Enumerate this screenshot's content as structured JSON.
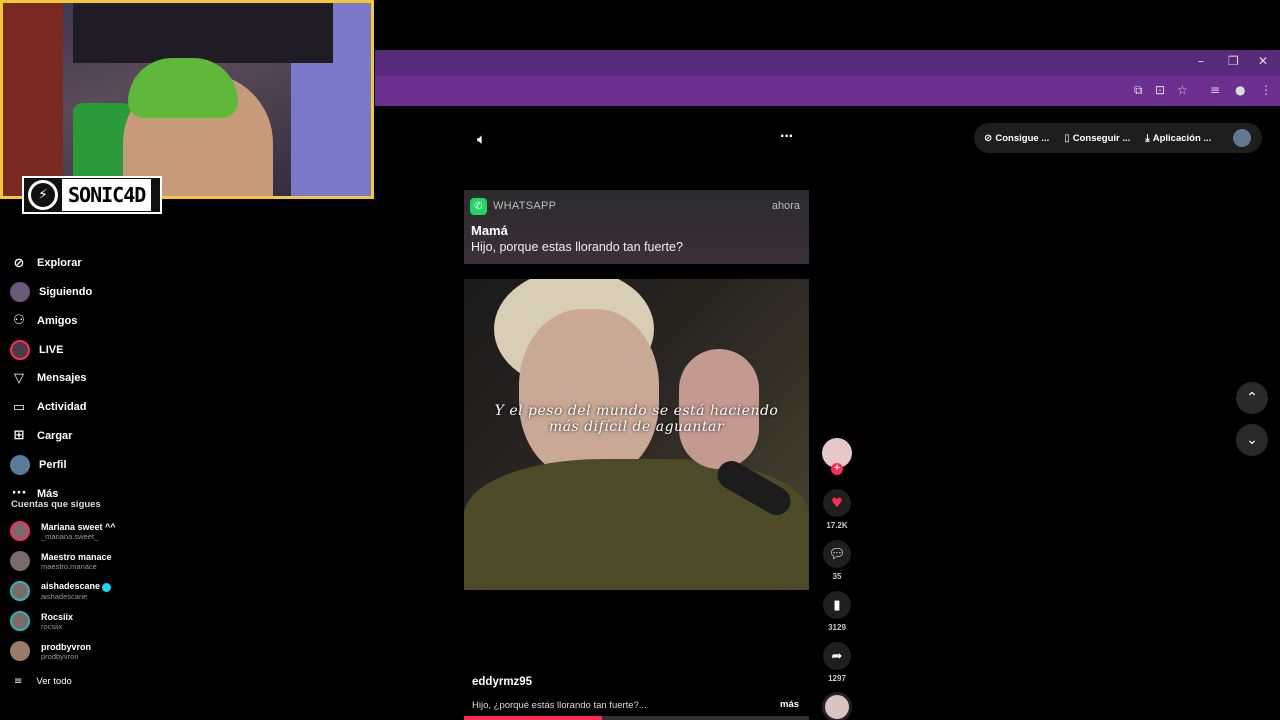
{
  "overlay": {
    "logo_text": "SONIC4D"
  },
  "sidebar": {
    "items": [
      {
        "label": "Explorar",
        "icon": "compass-icon"
      },
      {
        "label": "Siguiendo",
        "icon": "following-avatar-icon"
      },
      {
        "label": "Amigos",
        "icon": "friends-icon"
      },
      {
        "label": "LIVE",
        "icon": "live-icon"
      },
      {
        "label": "Mensajes",
        "icon": "messages-icon"
      },
      {
        "label": "Actividad",
        "icon": "activity-icon"
      },
      {
        "label": "Cargar",
        "icon": "upload-icon"
      },
      {
        "label": "Perfil",
        "icon": "profile-icon"
      },
      {
        "label": "Más",
        "icon": "more-icon"
      }
    ],
    "following_header": "Cuentas que sigues",
    "following": [
      {
        "name": "Mariana sweet ^^",
        "handle": "_mariana.sweet_"
      },
      {
        "name": "Maestro manace",
        "handle": "maestro.manace"
      },
      {
        "name": "aishadescane",
        "handle": "aishadescane"
      },
      {
        "name": "Rocsiix",
        "handle": "rocsiix"
      },
      {
        "name": "prodbyvron",
        "handle": "prodbyvron"
      }
    ],
    "see_all": "Ver todo"
  },
  "header": {
    "buttons": [
      {
        "label": "Consigue ..."
      },
      {
        "label": "Conseguir ..."
      },
      {
        "label": "Aplicación ..."
      }
    ]
  },
  "notification": {
    "app": "WHATSAPP",
    "time": "ahora",
    "sender": "Mamá",
    "message": "Hijo, porque estas llorando tan fuerte?"
  },
  "video": {
    "subtitle_line1": "Y el peso del mundo se está haciendo",
    "subtitle_line2": "más difícil de aguantar",
    "progress": 0.4
  },
  "actions": {
    "likes": "17.2K",
    "comments": "35",
    "saves": "3129",
    "shares": "1297"
  },
  "post": {
    "username": "eddyrmz95",
    "caption": "Hijo, ¿porqué estás llorando tan fuerte?...",
    "more": "más"
  },
  "colors": {
    "accent": "#fe2c55",
    "browser_frame": "#6b2f8f",
    "overlay_border": "#f2c83a"
  }
}
